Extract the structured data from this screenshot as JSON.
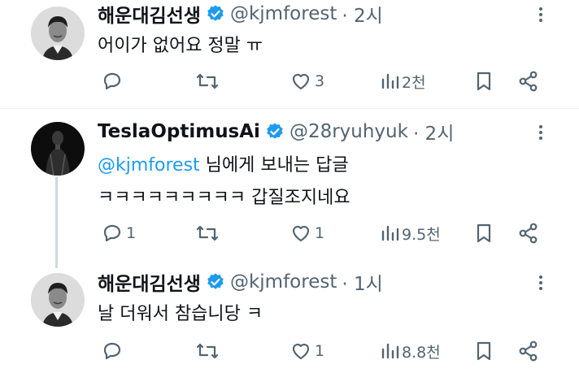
{
  "tweets": [
    {
      "display_name": "해운대김선생",
      "handle": "@kjmforest",
      "time": "· 2시",
      "body": "어이가 없어요 정말 ㅠ",
      "stats": {
        "replies": "",
        "retweets": "",
        "likes": "3",
        "views": "2천"
      }
    },
    {
      "display_name": "TeslaOptimusAi",
      "handle": "@28ryuhyuk",
      "time": "· 2시",
      "reply_to_mention": "@kjmforest",
      "reply_to_suffix": " 님에게 보내는 답글",
      "body": "ㅋㅋㅋㅋㅋㅋㅋㅋㅋ 갑질조지네요",
      "stats": {
        "replies": "1",
        "retweets": "",
        "likes": "1",
        "views": "9.5천"
      }
    },
    {
      "display_name": "해운대김선생",
      "handle": "@kjmforest",
      "time": "· 1시",
      "body": "날 더워서 참습니당 ㅋ",
      "stats": {
        "replies": "",
        "retweets": "",
        "likes": "1",
        "views": "8.8천"
      }
    }
  ],
  "colors": {
    "verified": "#1d9bf0",
    "mention": "#1d9bf0",
    "muted": "#536471",
    "divider": "#eff3f4"
  },
  "icons": [
    "verified-badge-icon",
    "more-icon",
    "reply-icon",
    "retweet-icon",
    "like-icon",
    "views-icon",
    "bookmark-icon",
    "share-icon"
  ]
}
